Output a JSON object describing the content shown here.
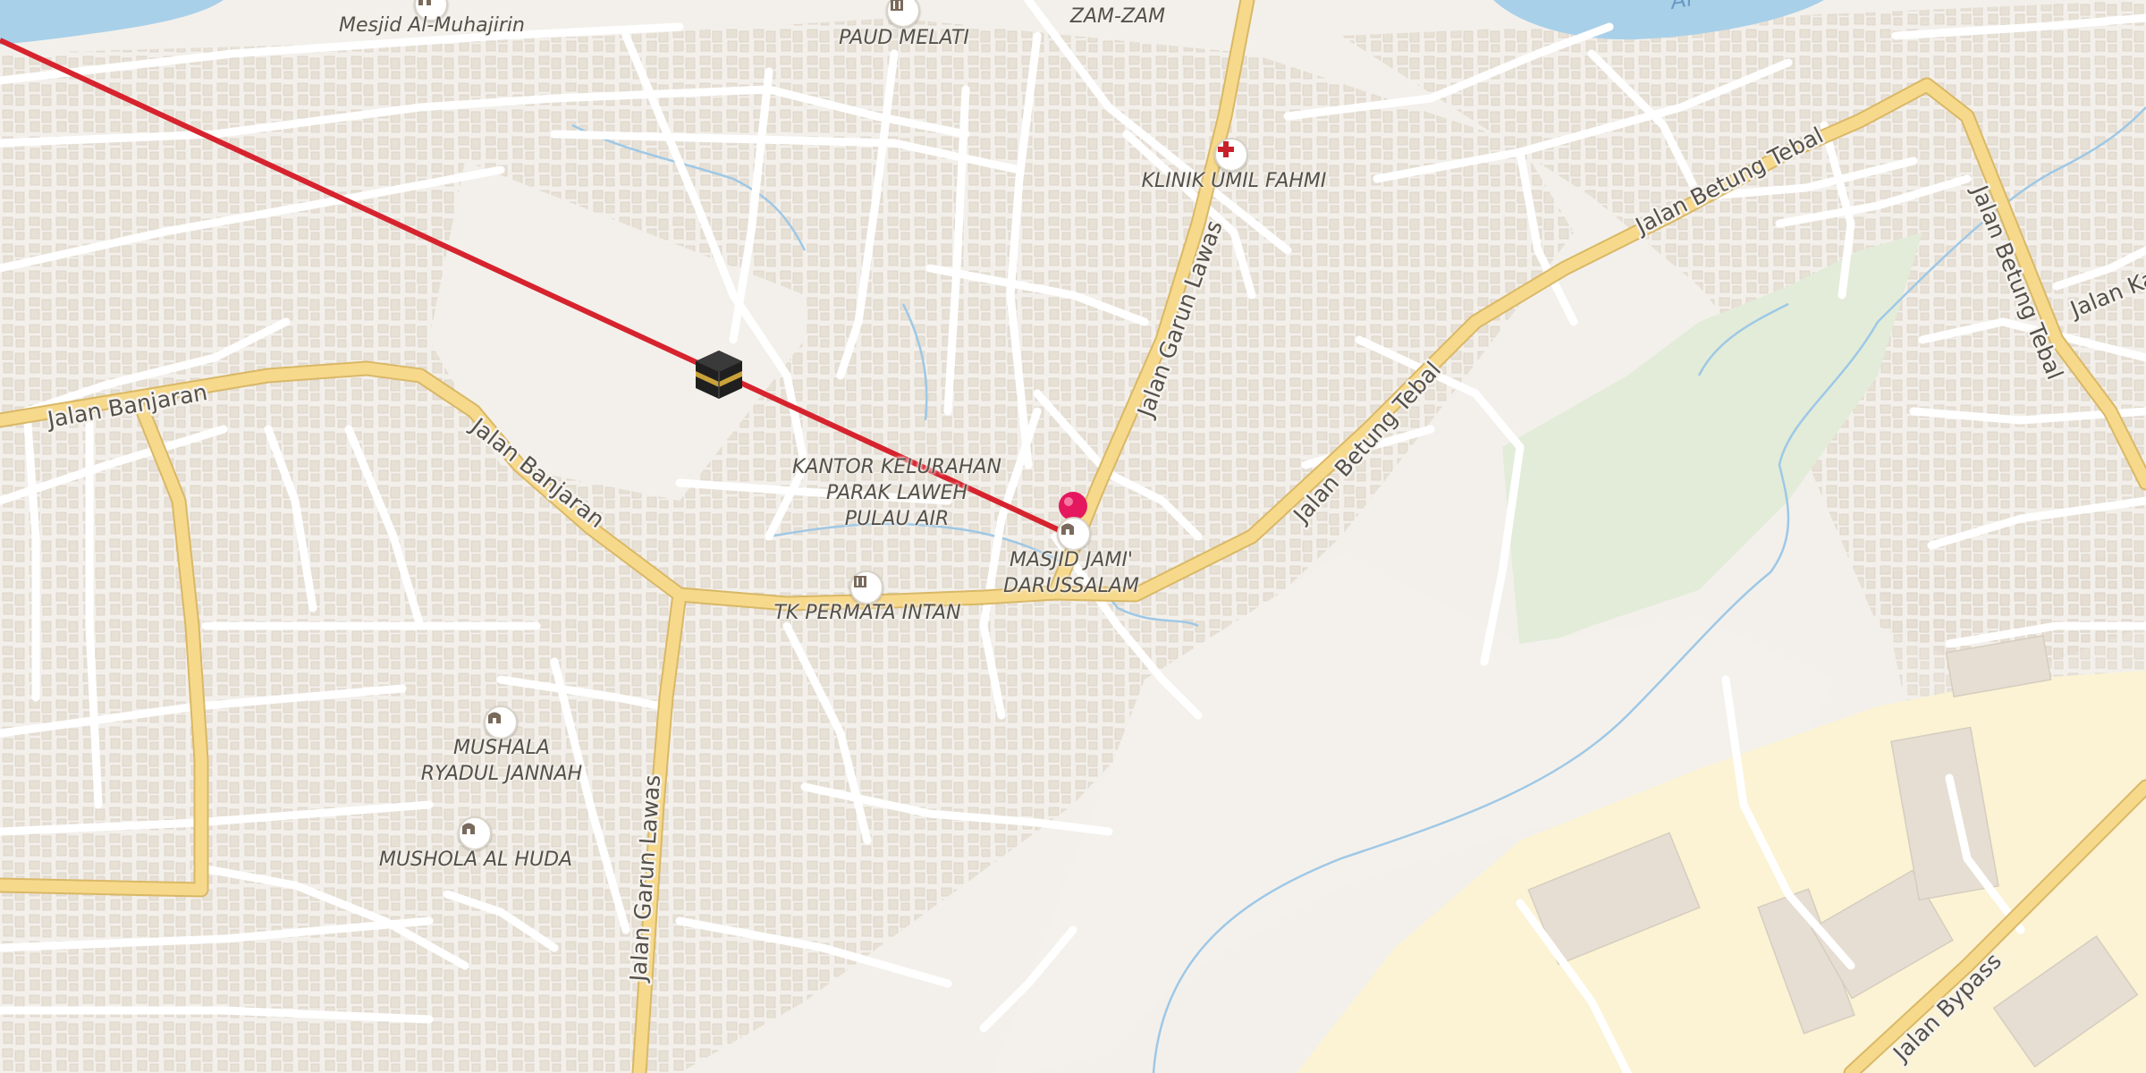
{
  "map": {
    "colors": {
      "land": "#f3f0eb",
      "water": "#a9d0e9",
      "minor_road": "#ffffff",
      "major_road": "#f7d98c",
      "building": "#e5ddd3",
      "park": "#e3ecd9",
      "industrial": "#fbf3d3",
      "qibla_line": "#d6232e",
      "pin": "#e5185f"
    },
    "labels": {
      "mesjid_al_muhajirin": "Mesjid Al-Muhajirin",
      "paud_melati": "PAUD MELATI",
      "zam_zam": "ZAM-ZAM",
      "klinik_umil_fahmi": "KLINIK UMIL FAHMI",
      "kantor_kelurahan_1": "KANTOR KELURAHAN",
      "kantor_kelurahan_2": "PARAK LAWEH",
      "kantor_kelurahan_3": "PULAU AIR",
      "masjid_jami_1": "MASJID JAMI'",
      "masjid_jami_2": "DARUSSALAM",
      "tk_permata_intan": "TK PERMATA INTAN",
      "mushala_ryadul_1": "MUSHALA",
      "mushala_ryadul_2": "RYADUL JANNAH",
      "mushola_al_huda": "MUSHOLA AL HUDA"
    },
    "streets": {
      "jalan_banjaran_w": "Jalan Banjaran",
      "jalan_banjaran_c": "Jalan Banjaran",
      "jalan_garun_lawas_n": "Jalan Garun Lawas",
      "jalan_garun_lawas_s": "Jalan Garun Lawas",
      "jalan_betung_tebal_1": "Jalan Betung Tebal",
      "jalan_betung_tebal_2": "Jalan Betung Tebal",
      "jalan_betung_tebal_3": "Jalan Betung Tebal",
      "jalan_ka": "Jalan Ka",
      "jalan_bypass": "Jalan Bypass",
      "water_label": "Ai"
    },
    "icons": {
      "qibla_marker": "kaaba-icon",
      "location_pin": "location-pin-icon",
      "clinic": "medical-cross-icon",
      "mosque": "mosque-icon",
      "school": "school-icon"
    }
  }
}
